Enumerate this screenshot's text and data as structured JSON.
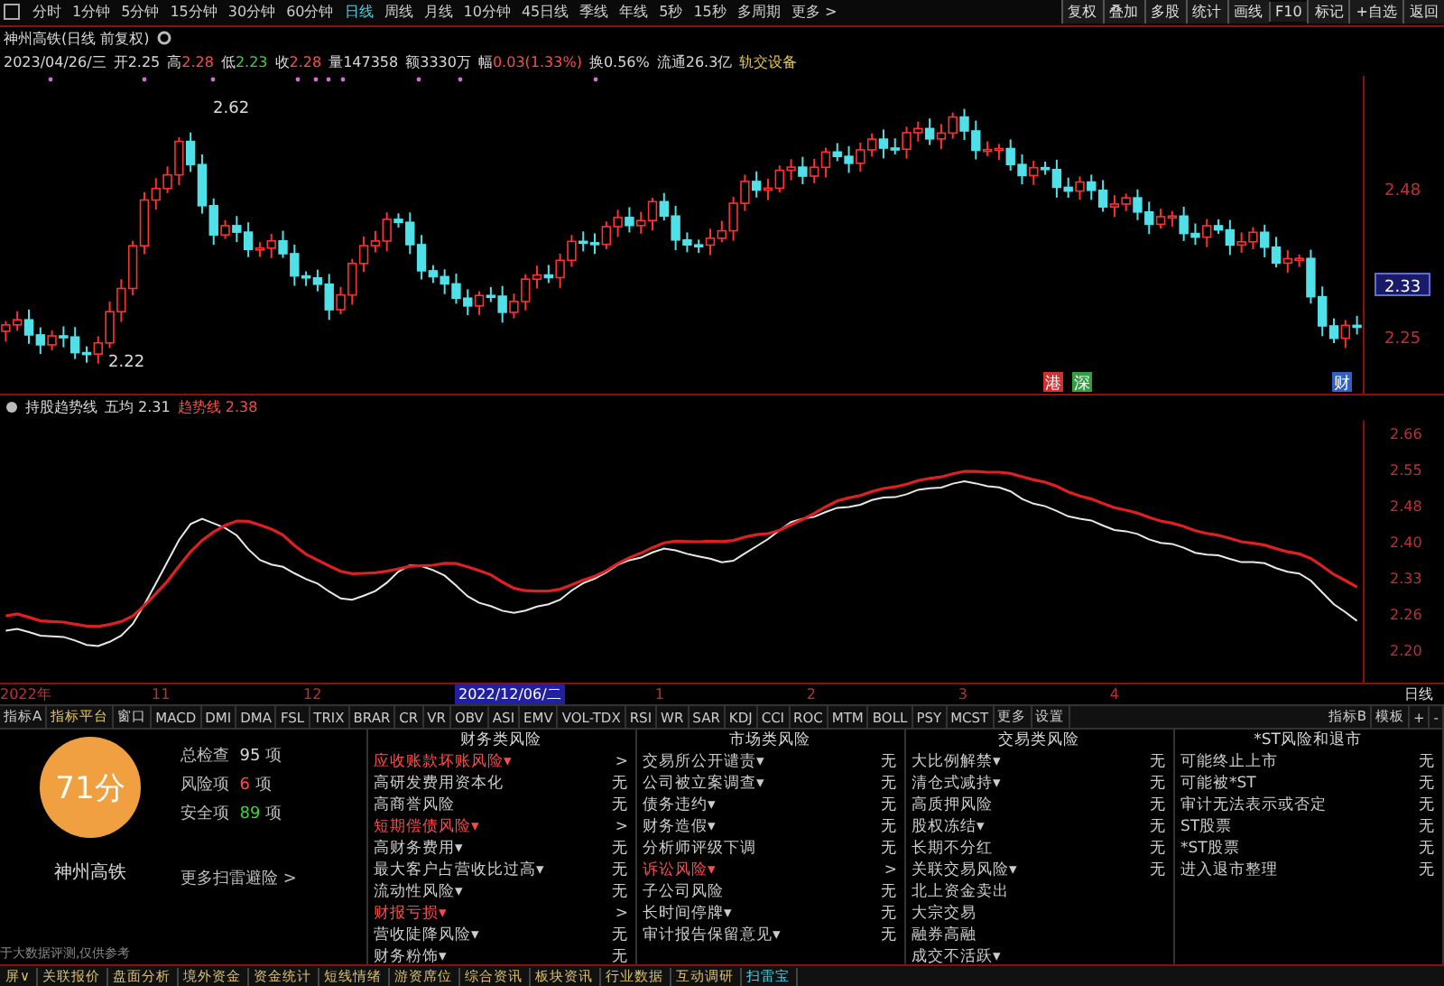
{
  "toolbar": {
    "periods": [
      {
        "label": "分时",
        "selected": false
      },
      {
        "label": "1分钟",
        "selected": false
      },
      {
        "label": "5分钟",
        "selected": false
      },
      {
        "label": "15分钟",
        "selected": false
      },
      {
        "label": "30分钟",
        "selected": false
      },
      {
        "label": "60分钟",
        "selected": false
      },
      {
        "label": "日线",
        "selected": true
      },
      {
        "label": "周线",
        "selected": false
      },
      {
        "label": "月线",
        "selected": false
      },
      {
        "label": "10分钟",
        "selected": false
      },
      {
        "label": "45日线",
        "selected": false
      },
      {
        "label": "季线",
        "selected": false
      },
      {
        "label": "年线",
        "selected": false
      },
      {
        "label": "5秒",
        "selected": false
      },
      {
        "label": "15秒",
        "selected": false
      },
      {
        "label": "多周期",
        "selected": false
      },
      {
        "label": "更多 >",
        "selected": false
      }
    ],
    "actions": [
      "复权",
      "叠加",
      "多股",
      "统计",
      "画线",
      "F10",
      "标记",
      "+自选",
      "返回"
    ]
  },
  "quote": {
    "title": "神州高铁(日线 前复权)",
    "fields": [
      {
        "value": "2023/04/26/三",
        "kind": "plain"
      },
      {
        "label": "开",
        "value": "2.25",
        "kind": "plain"
      },
      {
        "label": "高",
        "value": "2.28",
        "kind": "up"
      },
      {
        "label": "低",
        "value": "2.23",
        "kind": "down"
      },
      {
        "label": "收",
        "value": "2.28",
        "kind": "up"
      },
      {
        "label": "量",
        "value": "147358",
        "kind": "plain"
      },
      {
        "label": "额",
        "value": "3330万",
        "kind": "plain"
      },
      {
        "label": "幅",
        "value": "0.03(1.33%)",
        "kind": "up"
      },
      {
        "label": "换",
        "value": "0.56%",
        "kind": "plain"
      },
      {
        "label": "流通",
        "value": "26.3亿",
        "kind": "plain"
      },
      {
        "value": "轨交设备",
        "kind": "tag"
      }
    ]
  },
  "price_chart": {
    "high_label": "2.62",
    "low_label": "2.22",
    "axis": [
      {
        "text": "2.48",
        "selected": false
      },
      {
        "text": "2.33",
        "selected": true
      },
      {
        "text": "2.25",
        "selected": false
      }
    ],
    "markers": [
      {
        "text": "港",
        "color": "#d03030"
      },
      {
        "text": "深",
        "color": "#30a040"
      },
      {
        "text": "财",
        "color": "#3060c0"
      }
    ]
  },
  "indicator": {
    "name": "持股趋势线",
    "fields": [
      {
        "label": "五均",
        "value": "2.31",
        "kind": "plain"
      },
      {
        "label": "趋势线",
        "value": "2.38",
        "kind": "up"
      }
    ],
    "axis": [
      "2.66",
      "2.55",
      "2.48",
      "2.40",
      "2.33",
      "2.26",
      "2.20"
    ]
  },
  "date_axis": {
    "labels": [
      {
        "text": "2022年",
        "selected": false
      },
      {
        "text": "11",
        "selected": false
      },
      {
        "text": "12",
        "selected": false
      },
      {
        "text": "2022/12/06/二",
        "selected": true
      },
      {
        "text": "1",
        "selected": false
      },
      {
        "text": "2",
        "selected": false
      },
      {
        "text": "3",
        "selected": false
      },
      {
        "text": "4",
        "selected": false
      }
    ],
    "period": "日线"
  },
  "indicator_tabs": {
    "left": [
      {
        "label": "指标A",
        "selected": false
      },
      {
        "label": "指标平台",
        "selected": true
      },
      {
        "label": "窗口",
        "selected": false
      },
      {
        "label": "MACD",
        "selected": false
      },
      {
        "label": "DMI",
        "selected": false
      },
      {
        "label": "DMA",
        "selected": false
      },
      {
        "label": "FSL",
        "selected": false
      },
      {
        "label": "TRIX",
        "selected": false
      },
      {
        "label": "BRAR",
        "selected": false
      },
      {
        "label": "CR",
        "selected": false
      },
      {
        "label": "VR",
        "selected": false
      },
      {
        "label": "OBV",
        "selected": false
      },
      {
        "label": "ASI",
        "selected": false
      },
      {
        "label": "EMV",
        "selected": false
      },
      {
        "label": "VOL-TDX",
        "selected": false
      },
      {
        "label": "RSI",
        "selected": false
      },
      {
        "label": "WR",
        "selected": false
      },
      {
        "label": "SAR",
        "selected": false
      },
      {
        "label": "KDJ",
        "selected": false
      },
      {
        "label": "CCI",
        "selected": false
      },
      {
        "label": "ROC",
        "selected": false
      },
      {
        "label": "MTM",
        "selected": false
      },
      {
        "label": "BOLL",
        "selected": false
      },
      {
        "label": "PSY",
        "selected": false
      },
      {
        "label": "MCST",
        "selected": false
      },
      {
        "label": "更多",
        "selected": false
      },
      {
        "label": "设置",
        "selected": false
      }
    ],
    "right": [
      "指标B",
      "模板",
      "+",
      "-"
    ]
  },
  "scan": {
    "score": "71分",
    "name": "神州高铁",
    "stats": [
      {
        "label": "总检查",
        "value": "95",
        "unit": "项",
        "kind": "plain"
      },
      {
        "label": "风险项",
        "value": "6",
        "unit": "项",
        "kind": "risk"
      },
      {
        "label": "安全项",
        "value": "89",
        "unit": "项",
        "kind": "safe"
      }
    ],
    "more": "更多扫雷避险 >",
    "note": "于大数据评测,仅供参考",
    "columns": [
      {
        "title": "财务类风险",
        "items": [
          {
            "label": "应收账款坏账风险▾",
            "value": ">",
            "risk": true
          },
          {
            "label": "高研发费用资本化",
            "value": "无",
            "risk": false
          },
          {
            "label": "高商誉风险",
            "value": "无",
            "risk": false
          },
          {
            "label": "短期偿债风险▾",
            "value": ">",
            "risk": true
          },
          {
            "label": "高财务费用▾",
            "value": "无",
            "risk": false
          },
          {
            "label": "最大客户占营收比过高▾",
            "value": "无",
            "risk": false
          },
          {
            "label": "流动性风险▾",
            "value": "无",
            "risk": false
          },
          {
            "label": "财报亏损▾",
            "value": ">",
            "risk": true
          },
          {
            "label": "营收陡降风险▾",
            "value": "无",
            "risk": false
          },
          {
            "label": "财务粉饰▾",
            "value": "无",
            "risk": false
          }
        ]
      },
      {
        "title": "市场类风险",
        "items": [
          {
            "label": "交易所公开谴责▾",
            "value": "无",
            "risk": false
          },
          {
            "label": "公司被立案调查▾",
            "value": "无",
            "risk": false
          },
          {
            "label": "债务违约▾",
            "value": "无",
            "risk": false
          },
          {
            "label": "财务造假▾",
            "value": "无",
            "risk": false
          },
          {
            "label": "分析师评级下调",
            "value": "无",
            "risk": false
          },
          {
            "label": "诉讼风险▾",
            "value": ">",
            "risk": true
          },
          {
            "label": "子公司风险",
            "value": "无",
            "risk": false
          },
          {
            "label": "长时间停牌▾",
            "value": "无",
            "risk": false
          },
          {
            "label": "审计报告保留意见▾",
            "value": "无",
            "risk": false
          }
        ]
      },
      {
        "title": "交易类风险",
        "items": [
          {
            "label": "大比例解禁▾",
            "value": "无",
            "risk": false
          },
          {
            "label": "清仓式减持▾",
            "value": "无",
            "risk": false
          },
          {
            "label": "高质押风险",
            "value": "无",
            "risk": false
          },
          {
            "label": "股权冻结▾",
            "value": "无",
            "risk": false
          },
          {
            "label": "长期不分红",
            "value": "无",
            "risk": false
          },
          {
            "label": "关联交易风险▾",
            "value": "无",
            "risk": false
          },
          {
            "label": "北上资金卖出",
            "risk": false
          },
          {
            "label": "大宗交易",
            "risk": false
          },
          {
            "label": "融券高融",
            "risk": false
          },
          {
            "label": "成交不活跃▾",
            "risk": false
          }
        ]
      },
      {
        "title": "*ST风险和退市",
        "items": [
          {
            "label": "可能终止上市",
            "value": "无",
            "risk": false
          },
          {
            "label": "可能被*ST",
            "value": "无",
            "risk": false
          },
          {
            "label": "审计无法表示或否定",
            "value": "无",
            "risk": false
          },
          {
            "label": "ST股票",
            "value": "无",
            "risk": false
          },
          {
            "label": "*ST股票",
            "value": "无",
            "risk": false
          },
          {
            "label": "进入退市整理",
            "value": "无",
            "risk": false
          }
        ]
      }
    ]
  },
  "bottom_tabs": [
    {
      "label": "屏∨",
      "selected": false
    },
    {
      "label": "关联报价",
      "selected": false
    },
    {
      "label": "盘面分析",
      "selected": false
    },
    {
      "label": "境外资金",
      "selected": false
    },
    {
      "label": "资金统计",
      "selected": false
    },
    {
      "label": "短线情绪",
      "selected": false
    },
    {
      "label": "游资席位",
      "selected": false
    },
    {
      "label": "综合资讯",
      "selected": false
    },
    {
      "label": "板块资讯",
      "selected": false
    },
    {
      "label": "行业数据",
      "selected": false
    },
    {
      "label": "互动调研",
      "selected": false
    },
    {
      "label": "扫雷宝",
      "selected": true
    }
  ]
}
